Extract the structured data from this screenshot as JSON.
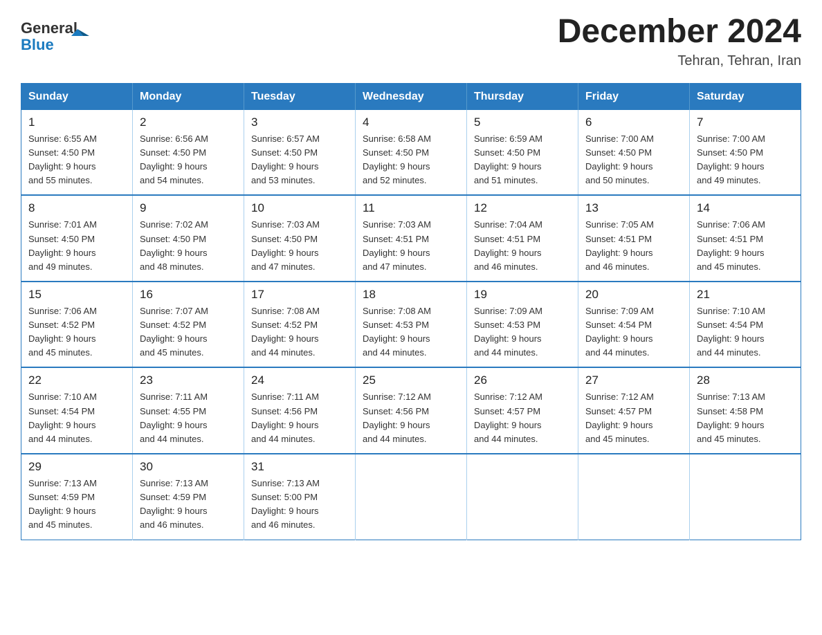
{
  "header": {
    "logo_text_general": "General",
    "logo_text_blue": "Blue",
    "month_title": "December 2024",
    "location": "Tehran, Tehran, Iran"
  },
  "weekdays": [
    "Sunday",
    "Monday",
    "Tuesday",
    "Wednesday",
    "Thursday",
    "Friday",
    "Saturday"
  ],
  "weeks": [
    [
      {
        "day": "1",
        "sunrise": "6:55 AM",
        "sunset": "4:50 PM",
        "daylight": "9 hours and 55 minutes."
      },
      {
        "day": "2",
        "sunrise": "6:56 AM",
        "sunset": "4:50 PM",
        "daylight": "9 hours and 54 minutes."
      },
      {
        "day": "3",
        "sunrise": "6:57 AM",
        "sunset": "4:50 PM",
        "daylight": "9 hours and 53 minutes."
      },
      {
        "day": "4",
        "sunrise": "6:58 AM",
        "sunset": "4:50 PM",
        "daylight": "9 hours and 52 minutes."
      },
      {
        "day": "5",
        "sunrise": "6:59 AM",
        "sunset": "4:50 PM",
        "daylight": "9 hours and 51 minutes."
      },
      {
        "day": "6",
        "sunrise": "7:00 AM",
        "sunset": "4:50 PM",
        "daylight": "9 hours and 50 minutes."
      },
      {
        "day": "7",
        "sunrise": "7:00 AM",
        "sunset": "4:50 PM",
        "daylight": "9 hours and 49 minutes."
      }
    ],
    [
      {
        "day": "8",
        "sunrise": "7:01 AM",
        "sunset": "4:50 PM",
        "daylight": "9 hours and 49 minutes."
      },
      {
        "day": "9",
        "sunrise": "7:02 AM",
        "sunset": "4:50 PM",
        "daylight": "9 hours and 48 minutes."
      },
      {
        "day": "10",
        "sunrise": "7:03 AM",
        "sunset": "4:50 PM",
        "daylight": "9 hours and 47 minutes."
      },
      {
        "day": "11",
        "sunrise": "7:03 AM",
        "sunset": "4:51 PM",
        "daylight": "9 hours and 47 minutes."
      },
      {
        "day": "12",
        "sunrise": "7:04 AM",
        "sunset": "4:51 PM",
        "daylight": "9 hours and 46 minutes."
      },
      {
        "day": "13",
        "sunrise": "7:05 AM",
        "sunset": "4:51 PM",
        "daylight": "9 hours and 46 minutes."
      },
      {
        "day": "14",
        "sunrise": "7:06 AM",
        "sunset": "4:51 PM",
        "daylight": "9 hours and 45 minutes."
      }
    ],
    [
      {
        "day": "15",
        "sunrise": "7:06 AM",
        "sunset": "4:52 PM",
        "daylight": "9 hours and 45 minutes."
      },
      {
        "day": "16",
        "sunrise": "7:07 AM",
        "sunset": "4:52 PM",
        "daylight": "9 hours and 45 minutes."
      },
      {
        "day": "17",
        "sunrise": "7:08 AM",
        "sunset": "4:52 PM",
        "daylight": "9 hours and 44 minutes."
      },
      {
        "day": "18",
        "sunrise": "7:08 AM",
        "sunset": "4:53 PM",
        "daylight": "9 hours and 44 minutes."
      },
      {
        "day": "19",
        "sunrise": "7:09 AM",
        "sunset": "4:53 PM",
        "daylight": "9 hours and 44 minutes."
      },
      {
        "day": "20",
        "sunrise": "7:09 AM",
        "sunset": "4:54 PM",
        "daylight": "9 hours and 44 minutes."
      },
      {
        "day": "21",
        "sunrise": "7:10 AM",
        "sunset": "4:54 PM",
        "daylight": "9 hours and 44 minutes."
      }
    ],
    [
      {
        "day": "22",
        "sunrise": "7:10 AM",
        "sunset": "4:54 PM",
        "daylight": "9 hours and 44 minutes."
      },
      {
        "day": "23",
        "sunrise": "7:11 AM",
        "sunset": "4:55 PM",
        "daylight": "9 hours and 44 minutes."
      },
      {
        "day": "24",
        "sunrise": "7:11 AM",
        "sunset": "4:56 PM",
        "daylight": "9 hours and 44 minutes."
      },
      {
        "day": "25",
        "sunrise": "7:12 AM",
        "sunset": "4:56 PM",
        "daylight": "9 hours and 44 minutes."
      },
      {
        "day": "26",
        "sunrise": "7:12 AM",
        "sunset": "4:57 PM",
        "daylight": "9 hours and 44 minutes."
      },
      {
        "day": "27",
        "sunrise": "7:12 AM",
        "sunset": "4:57 PM",
        "daylight": "9 hours and 45 minutes."
      },
      {
        "day": "28",
        "sunrise": "7:13 AM",
        "sunset": "4:58 PM",
        "daylight": "9 hours and 45 minutes."
      }
    ],
    [
      {
        "day": "29",
        "sunrise": "7:13 AM",
        "sunset": "4:59 PM",
        "daylight": "9 hours and 45 minutes."
      },
      {
        "day": "30",
        "sunrise": "7:13 AM",
        "sunset": "4:59 PM",
        "daylight": "9 hours and 46 minutes."
      },
      {
        "day": "31",
        "sunrise": "7:13 AM",
        "sunset": "5:00 PM",
        "daylight": "9 hours and 46 minutes."
      },
      null,
      null,
      null,
      null
    ]
  ],
  "labels": {
    "sunrise": "Sunrise:",
    "sunset": "Sunset:",
    "daylight": "Daylight:"
  }
}
